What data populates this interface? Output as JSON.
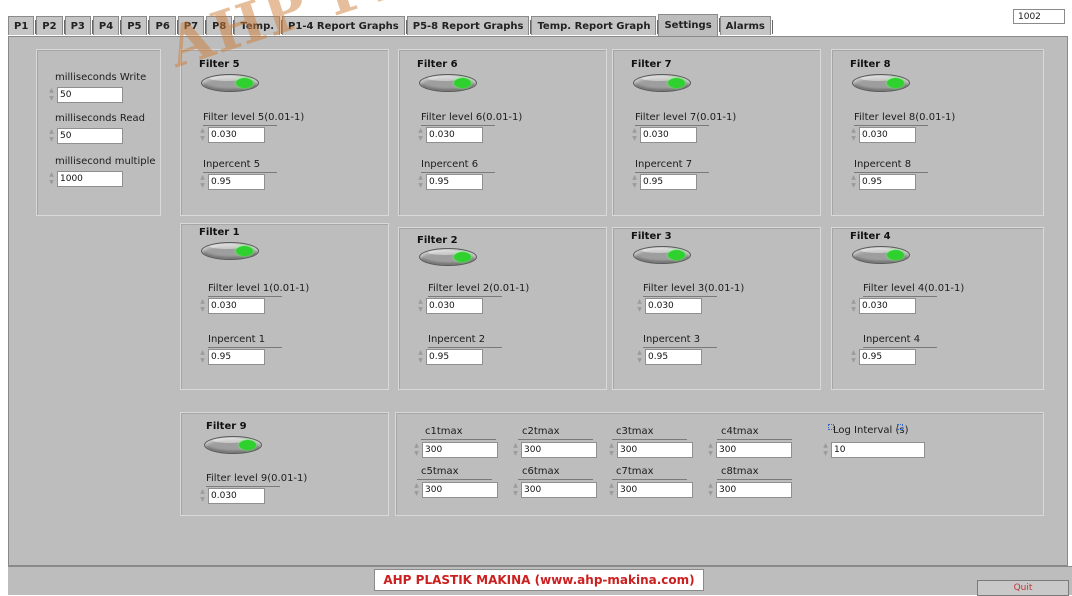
{
  "tabs": [
    "P1",
    "P2",
    "P3",
    "P4",
    "P5",
    "P6",
    "P7",
    "P8",
    "Temp.",
    "P1-4 Report Graphs",
    "P5-8 Report Graphs",
    "Temp. Report Graph",
    "Settings",
    "Alarms"
  ],
  "active_tab": "Settings",
  "top_value": "1002",
  "watermark": "AHP PLASTIK",
  "timing": {
    "write_label": "milliseconds Write",
    "write_value": "50",
    "read_label": "milliseconds Read",
    "read_value": "50",
    "multiple_label": "millisecond multiple",
    "multiple_value": "1000"
  },
  "filters": {
    "f5": {
      "title": "Filter 5",
      "level_label": "Filter level 5(0.01-1)",
      "level": "0.030",
      "pct_label": "Inpercent 5",
      "pct": "0.95"
    },
    "f6": {
      "title": "Filter 6",
      "level_label": "Filter level 6(0.01-1)",
      "level": "0.030",
      "pct_label": "Inpercent 6",
      "pct": "0.95"
    },
    "f7": {
      "title": "Filter 7",
      "level_label": "Filter level 7(0.01-1)",
      "level": "0.030",
      "pct_label": "Inpercent 7",
      "pct": "0.95"
    },
    "f8": {
      "title": "Filter 8",
      "level_label": "Filter level 8(0.01-1)",
      "level": "0.030",
      "pct_label": "Inpercent 8",
      "pct": "0.95"
    },
    "f1": {
      "title": "Filter 1",
      "level_label": "Filter level 1(0.01-1)",
      "level": "0.030",
      "pct_label": "Inpercent 1",
      "pct": "0.95"
    },
    "f2": {
      "title": "Filter 2",
      "level_label": "Filter level 2(0.01-1)",
      "level": "0.030",
      "pct_label": "Inpercent 2",
      "pct": "0.95"
    },
    "f3": {
      "title": "Filter 3",
      "level_label": "Filter level 3(0.01-1)",
      "level": "0.030",
      "pct_label": "Inpercent 3",
      "pct": "0.95"
    },
    "f4": {
      "title": "Filter 4",
      "level_label": "Filter level 4(0.01-1)",
      "level": "0.030",
      "pct_label": "Inpercent 4",
      "pct": "0.95"
    },
    "f9": {
      "title": "Filter 9",
      "level_label": "Filter level 9(0.01-1)",
      "level": "0.030"
    }
  },
  "tmax": [
    {
      "label": "c1tmax",
      "value": "300"
    },
    {
      "label": "c2tmax",
      "value": "300"
    },
    {
      "label": "c3tmax",
      "value": "300"
    },
    {
      "label": "c4tmax",
      "value": "300"
    },
    {
      "label": "c5tmax",
      "value": "300"
    },
    {
      "label": "c6tmax",
      "value": "300"
    },
    {
      "label": "c7tmax",
      "value": "300"
    },
    {
      "label": "c8tmax",
      "value": "300"
    }
  ],
  "log_interval": {
    "label": "Log Interval (s)",
    "value": "10"
  },
  "footer": {
    "banner": "AHP PLASTIK MAKINA (www.ahp-makina.com)",
    "quit": "Quit"
  },
  "colors": {
    "panel": "#bdbdbd",
    "led_on": "#2fd12f",
    "banner_text": "#cc1f1f"
  }
}
